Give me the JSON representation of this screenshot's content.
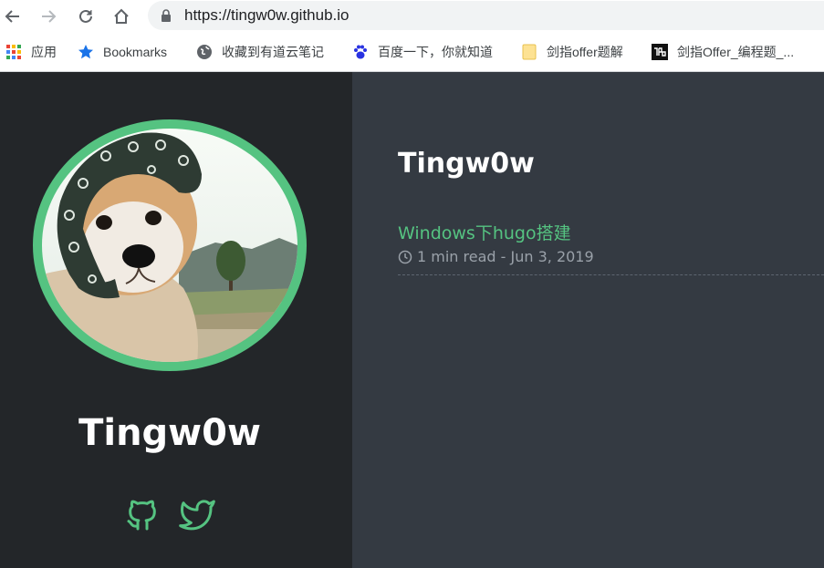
{
  "browser": {
    "url": "https://tingw0w.github.io",
    "bookmarks": [
      {
        "label": "应用",
        "icon": "apps-grid-icon"
      },
      {
        "label": "Bookmarks",
        "icon": "star-icon"
      },
      {
        "label": "收藏到有道云笔记",
        "icon": "globe-icon"
      },
      {
        "label": "百度一下，你就知道",
        "icon": "baidu-paw-icon"
      },
      {
        "label": "剑指offer题解",
        "icon": "folder-icon"
      },
      {
        "label": "剑指Offer_编程题_...",
        "icon": "nowcoder-icon"
      }
    ]
  },
  "sidebar": {
    "name": "Tingw0w",
    "social": [
      "github-icon",
      "twitter-icon"
    ]
  },
  "main": {
    "site_title": "Tingw0w",
    "posts": [
      {
        "title": "Windows下hugo搭建",
        "meta": "1 min read - Jun 3, 2019"
      }
    ]
  },
  "colors": {
    "accent": "#55c381",
    "sidebar_bg": "#232629",
    "content_bg": "#343a42"
  }
}
